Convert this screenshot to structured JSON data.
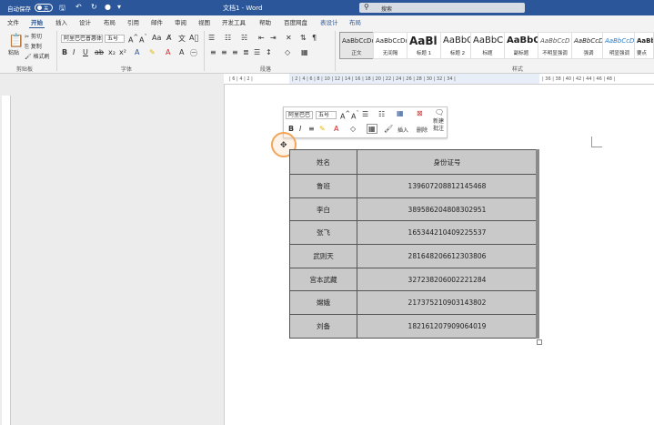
{
  "titlebar": {
    "autosave_label": "自动保存",
    "toggle_state": "关",
    "doc_title": "文档1 - Word",
    "search_placeholder": "搜索"
  },
  "tabs": [
    "文件",
    "开始",
    "插入",
    "设计",
    "布局",
    "引用",
    "邮件",
    "审阅",
    "视图",
    "开发工具",
    "帮助",
    "百度网盘",
    "表设计",
    "布局"
  ],
  "ribbon": {
    "clipboard": {
      "paste": "粘贴",
      "cut": "剪切",
      "copy": "复制",
      "format_painter": "格式刷",
      "group_label": "剪贴板"
    },
    "font": {
      "font_name": "阿里巴巴普惠体",
      "font_size": "五号",
      "group_label": "字体"
    },
    "paragraph": {
      "group_label": "段落"
    },
    "styles": {
      "group_label": "样式",
      "items": [
        {
          "sample": "AaBbCcDd",
          "name": "正文"
        },
        {
          "sample": "AaBbCcDd",
          "name": "无间隔"
        },
        {
          "sample": "AaBl",
          "name": "标题 1"
        },
        {
          "sample": "AaBbC",
          "name": "标题 2"
        },
        {
          "sample": "AaBbC",
          "name": "标题"
        },
        {
          "sample": "AaBbC",
          "name": "副标题"
        },
        {
          "sample": "AaBbCcD",
          "name": "不明显强调"
        },
        {
          "sample": "AaBbCcD",
          "name": "强调"
        },
        {
          "sample": "AaBbCcD",
          "name": "明显强调"
        },
        {
          "sample": "AaBbC",
          "name": "要点"
        }
      ]
    }
  },
  "mini_toolbar": {
    "font_name": "阿里巴巴",
    "font_size": "五号",
    "insert_label": "插入",
    "delete_label": "删除",
    "new_comment_label": "新建批注"
  },
  "table": {
    "headers": [
      "姓名",
      "身份证号"
    ],
    "rows": [
      [
        "鲁班",
        "139607208812145468"
      ],
      [
        "李白",
        "389586204808302951"
      ],
      [
        "张飞",
        "165344210409225537"
      ],
      [
        "武则天",
        "281648206612303806"
      ],
      [
        "宫本武藏",
        "327238206002221284"
      ],
      [
        "嫦娥",
        "217375210903143802"
      ],
      [
        "刘备",
        "182161207909064019"
      ]
    ]
  },
  "colors": {
    "brand": "#2b579a",
    "table_fill": "#c9c9c9",
    "move_ring": "#f2a65a"
  }
}
